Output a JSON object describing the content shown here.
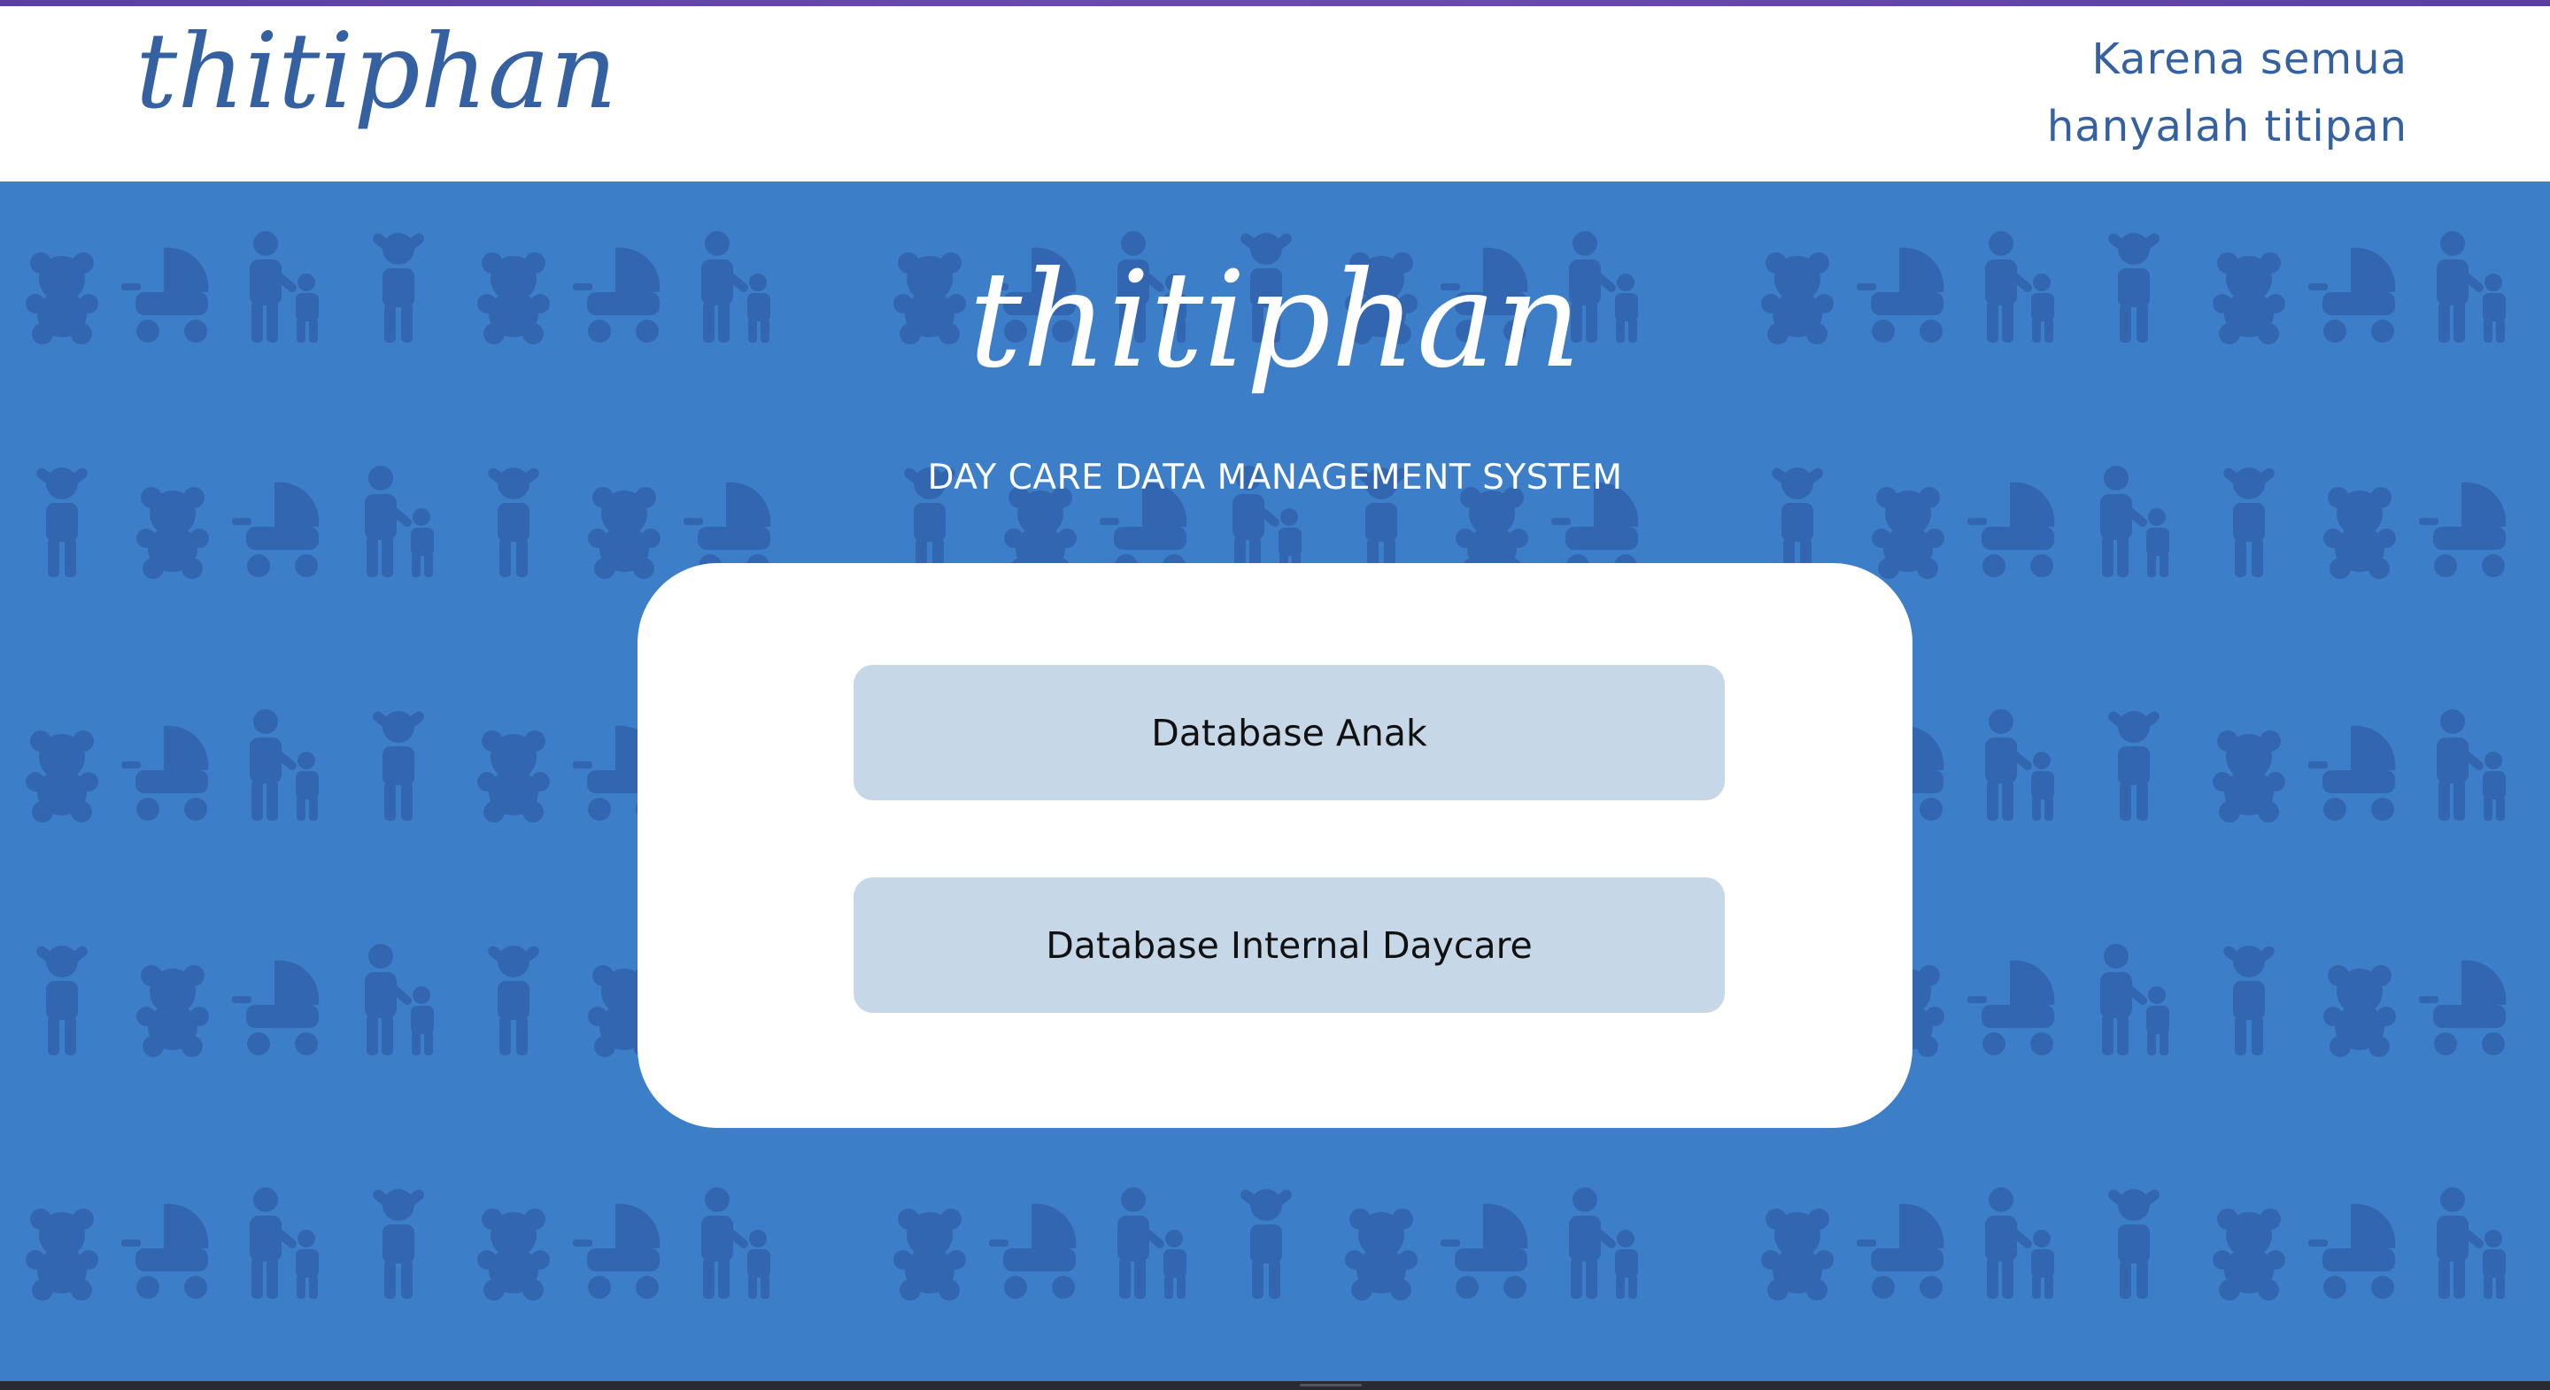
{
  "brand": {
    "name": "thitiphan",
    "tagline_line1": "Karena semua",
    "tagline_line2": "hanyalah titipan"
  },
  "hero": {
    "logo_text": "thitiphan",
    "subtitle": "DAY CARE DATA MANAGEMENT SYSTEM"
  },
  "menu": {
    "buttons": [
      {
        "label": "Database Anak"
      },
      {
        "label": "Database Internal Daycare"
      }
    ]
  },
  "colors": {
    "background": "#3d7ec8",
    "pattern": "#3366b0",
    "header_bg": "#ffffff",
    "brand_text": "#3561a0",
    "button_bg": "#c6d7e7",
    "accent_bar": "#5b3fa6"
  },
  "pattern_icons": [
    "teddy-bear-icon",
    "stroller-icon",
    "parent-child-icon",
    "child-arms-up-icon"
  ]
}
